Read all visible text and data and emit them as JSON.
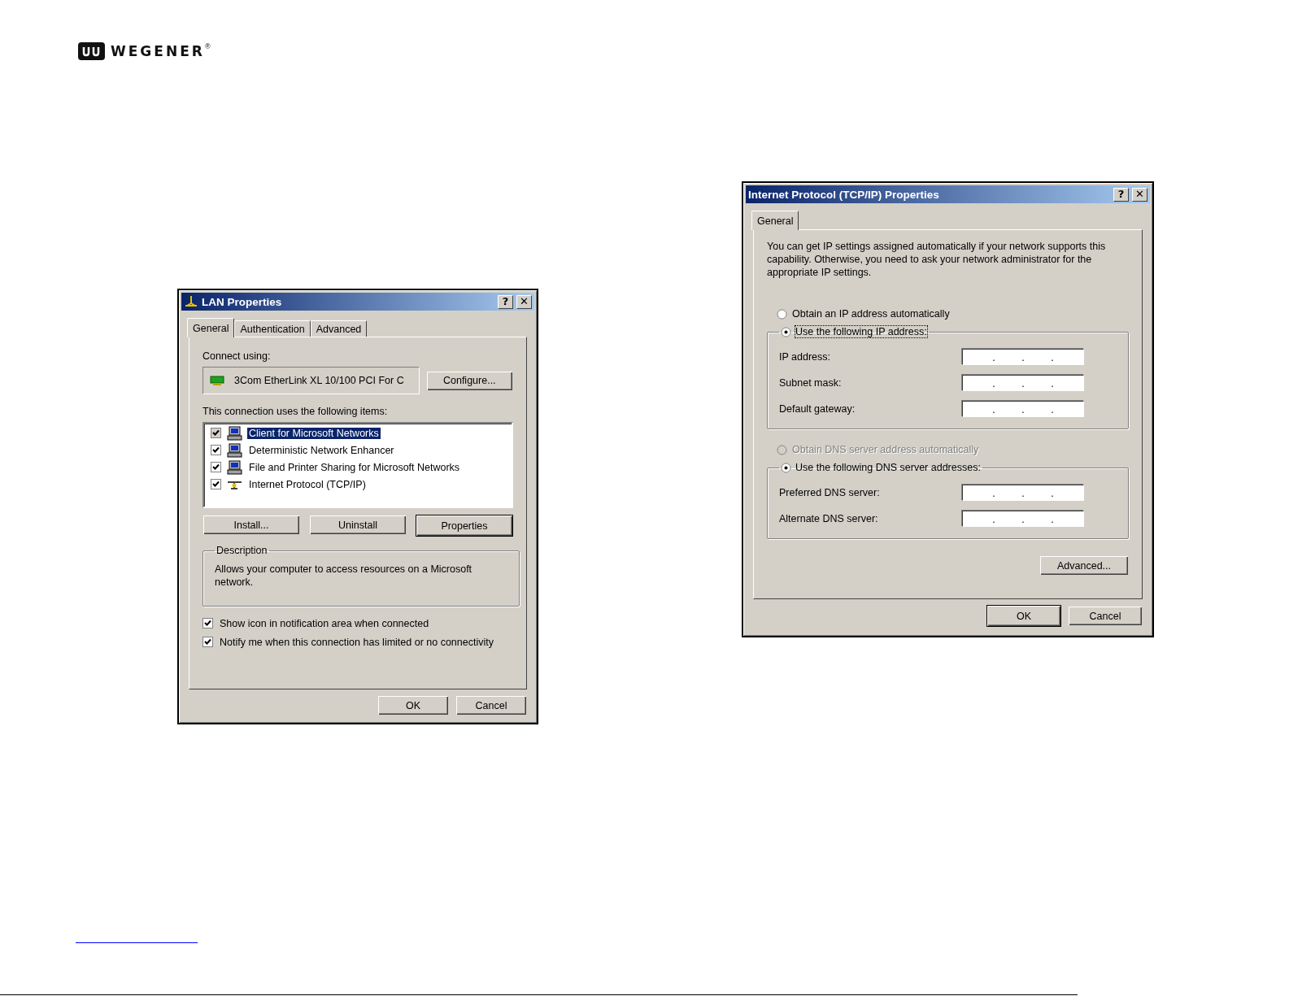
{
  "logo": {
    "text": "WEGENER",
    "mark": "®"
  },
  "lan_dialog": {
    "title": "LAN Properties",
    "title_buttons": [
      "?",
      "✕"
    ],
    "tabs": [
      {
        "label": "General",
        "selected": true
      },
      {
        "label": "Authentication",
        "selected": false
      },
      {
        "label": "Advanced",
        "selected": false
      }
    ],
    "connect_using_label": "Connect using:",
    "adapter": "3Com EtherLink XL 10/100 PCI For C",
    "configure_button": {
      "label": "Configure...",
      "default": false
    },
    "items_label": "This connection uses the following items:",
    "items": [
      {
        "label": "Client for Microsoft Networks",
        "checked": true,
        "selected": true,
        "kind": "computer"
      },
      {
        "label": "Deterministic Network Enhancer",
        "checked": true,
        "selected": false,
        "kind": "computer"
      },
      {
        "label": "File and Printer Sharing for Microsoft Networks",
        "checked": true,
        "selected": false,
        "kind": "computer"
      },
      {
        "label": "Internet Protocol (TCP/IP)",
        "checked": true,
        "selected": false,
        "kind": "protocol"
      }
    ],
    "item_buttons": [
      {
        "label": "Install...",
        "default": false
      },
      {
        "label": "Uninstall",
        "default": false
      },
      {
        "label": "Properties",
        "default": true
      }
    ],
    "description": {
      "legend": "Description",
      "text": "Allows your computer to access resources on a Microsoft network."
    },
    "options": [
      {
        "label": "Show icon in notification area when connected",
        "checked": true
      },
      {
        "label": "Notify me when this connection has limited or no connectivity",
        "checked": true
      }
    ],
    "footer_buttons": [
      {
        "label": "OK",
        "default": false
      },
      {
        "label": "Cancel",
        "default": false
      }
    ]
  },
  "tcpip_dialog": {
    "title": "Internet Protocol (TCP/IP) Properties",
    "title_buttons": [
      "?",
      "✕"
    ],
    "tabs": [
      {
        "label": "General",
        "selected": true
      }
    ],
    "intro": "You can get IP settings assigned automatically if your network supports this capability. Otherwise, you need to ask your network administrator for the appropriate IP settings.",
    "ip_auto": {
      "label": "Obtain an IP address automatically",
      "selected": false,
      "disabled": false
    },
    "ip_manual": {
      "label": "Use the following IP address:",
      "selected": true,
      "disabled": false,
      "focused": true
    },
    "ip_fields": [
      {
        "label": "IP address:",
        "separators": [
          ".",
          ".",
          "."
        ]
      },
      {
        "label": "Subnet mask:",
        "separators": [
          ".",
          ".",
          "."
        ]
      },
      {
        "label": "Default gateway:",
        "separators": [
          ".",
          ".",
          "."
        ]
      }
    ],
    "dns_auto": {
      "label": "Obtain DNS server address automatically",
      "selected": false,
      "disabled": true
    },
    "dns_manual": {
      "label": "Use the following DNS server addresses:",
      "selected": true,
      "disabled": false,
      "focused": false
    },
    "dns_fields": [
      {
        "label": "Preferred DNS server:",
        "separators": [
          ".",
          ".",
          "."
        ]
      },
      {
        "label": "Alternate DNS server:",
        "separators": [
          ".",
          ".",
          "."
        ]
      }
    ],
    "advanced_button": {
      "label": "Advanced...",
      "default": false
    },
    "footer_buttons": [
      {
        "label": "OK",
        "default": true
      },
      {
        "label": "Cancel",
        "default": false
      }
    ]
  }
}
